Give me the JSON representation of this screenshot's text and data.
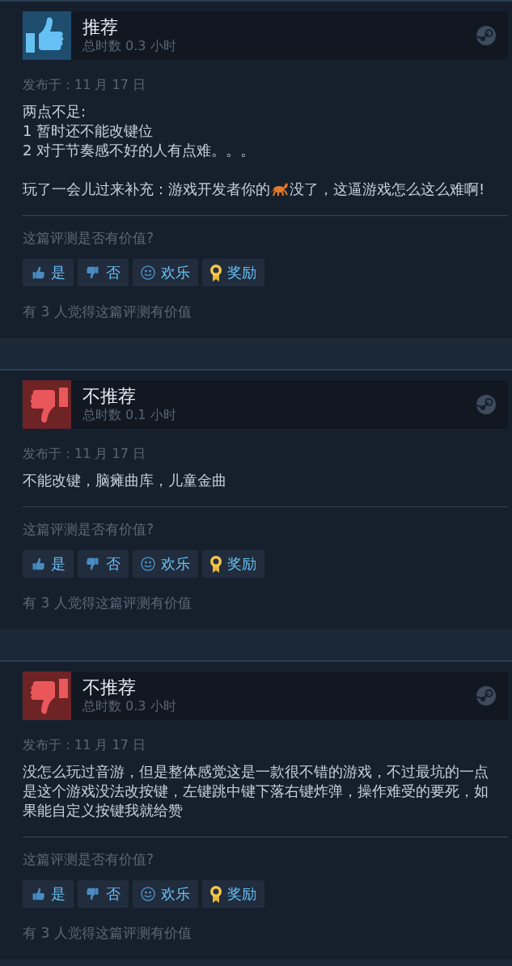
{
  "reviews": [
    {
      "recommended": true,
      "verdict": "推荐",
      "hours": "总时数 0.3 小时",
      "posted": "发布于：11 月 17 日",
      "paragraphs": [
        {
          "lines": [
            {
              "text": "两点不足:"
            },
            {
              "text": "1 暂时还不能改键位"
            },
            {
              "text": "2 对于节奏感不好的人有点难。。。"
            }
          ]
        },
        {
          "lines": [
            {
              "parts": [
                {
                  "kind": "text",
                  "text": "玩了一会儿过来补充：游戏开发者你的"
                },
                {
                  "kind": "horse"
                },
                {
                  "kind": "text",
                  "text": "没了，这逼游戏怎么这么难啊!"
                }
              ]
            }
          ]
        }
      ],
      "prompt": "这篇评测是否有价值?",
      "buttons": [
        {
          "kind": "yes",
          "label": "是"
        },
        {
          "kind": "no",
          "label": "否"
        },
        {
          "kind": "funny",
          "label": "欢乐"
        },
        {
          "kind": "award",
          "label": "奖励"
        }
      ],
      "helpful": "有 3 人觉得这篇评测有价值"
    },
    {
      "recommended": false,
      "verdict": "不推荐",
      "hours": "总时数 0.1 小时",
      "posted": "发布于：11 月 17 日",
      "paragraphs": [
        {
          "lines": [
            {
              "text": "不能改键，脑瘫曲库，儿童金曲"
            }
          ]
        }
      ],
      "prompt": "这篇评测是否有价值?",
      "buttons": [
        {
          "kind": "yes",
          "label": "是"
        },
        {
          "kind": "no",
          "label": "否"
        },
        {
          "kind": "funny",
          "label": "欢乐"
        },
        {
          "kind": "award",
          "label": "奖励"
        }
      ],
      "helpful": "有 3 人觉得这篇评测有价值"
    },
    {
      "recommended": false,
      "verdict": "不推荐",
      "hours": "总时数 0.3 小时",
      "posted": "发布于：11 月 17 日",
      "paragraphs": [
        {
          "lines": [
            {
              "text": "没怎么玩过音游，但是整体感觉这是一款很不错的游戏，不过最坑的一点是这个游戏没法改按键，左键跳中键下落右键炸弹，操作难受的要死，如果能自定义按键我就给赞"
            }
          ]
        }
      ],
      "prompt": "这篇评测是否有价值?",
      "buttons": [
        {
          "kind": "yes",
          "label": "是"
        },
        {
          "kind": "no",
          "label": "否"
        },
        {
          "kind": "funny",
          "label": "欢乐"
        },
        {
          "kind": "award",
          "label": "奖励"
        }
      ],
      "helpful": "有 3 人觉得这篇评测有价值"
    }
  ]
}
